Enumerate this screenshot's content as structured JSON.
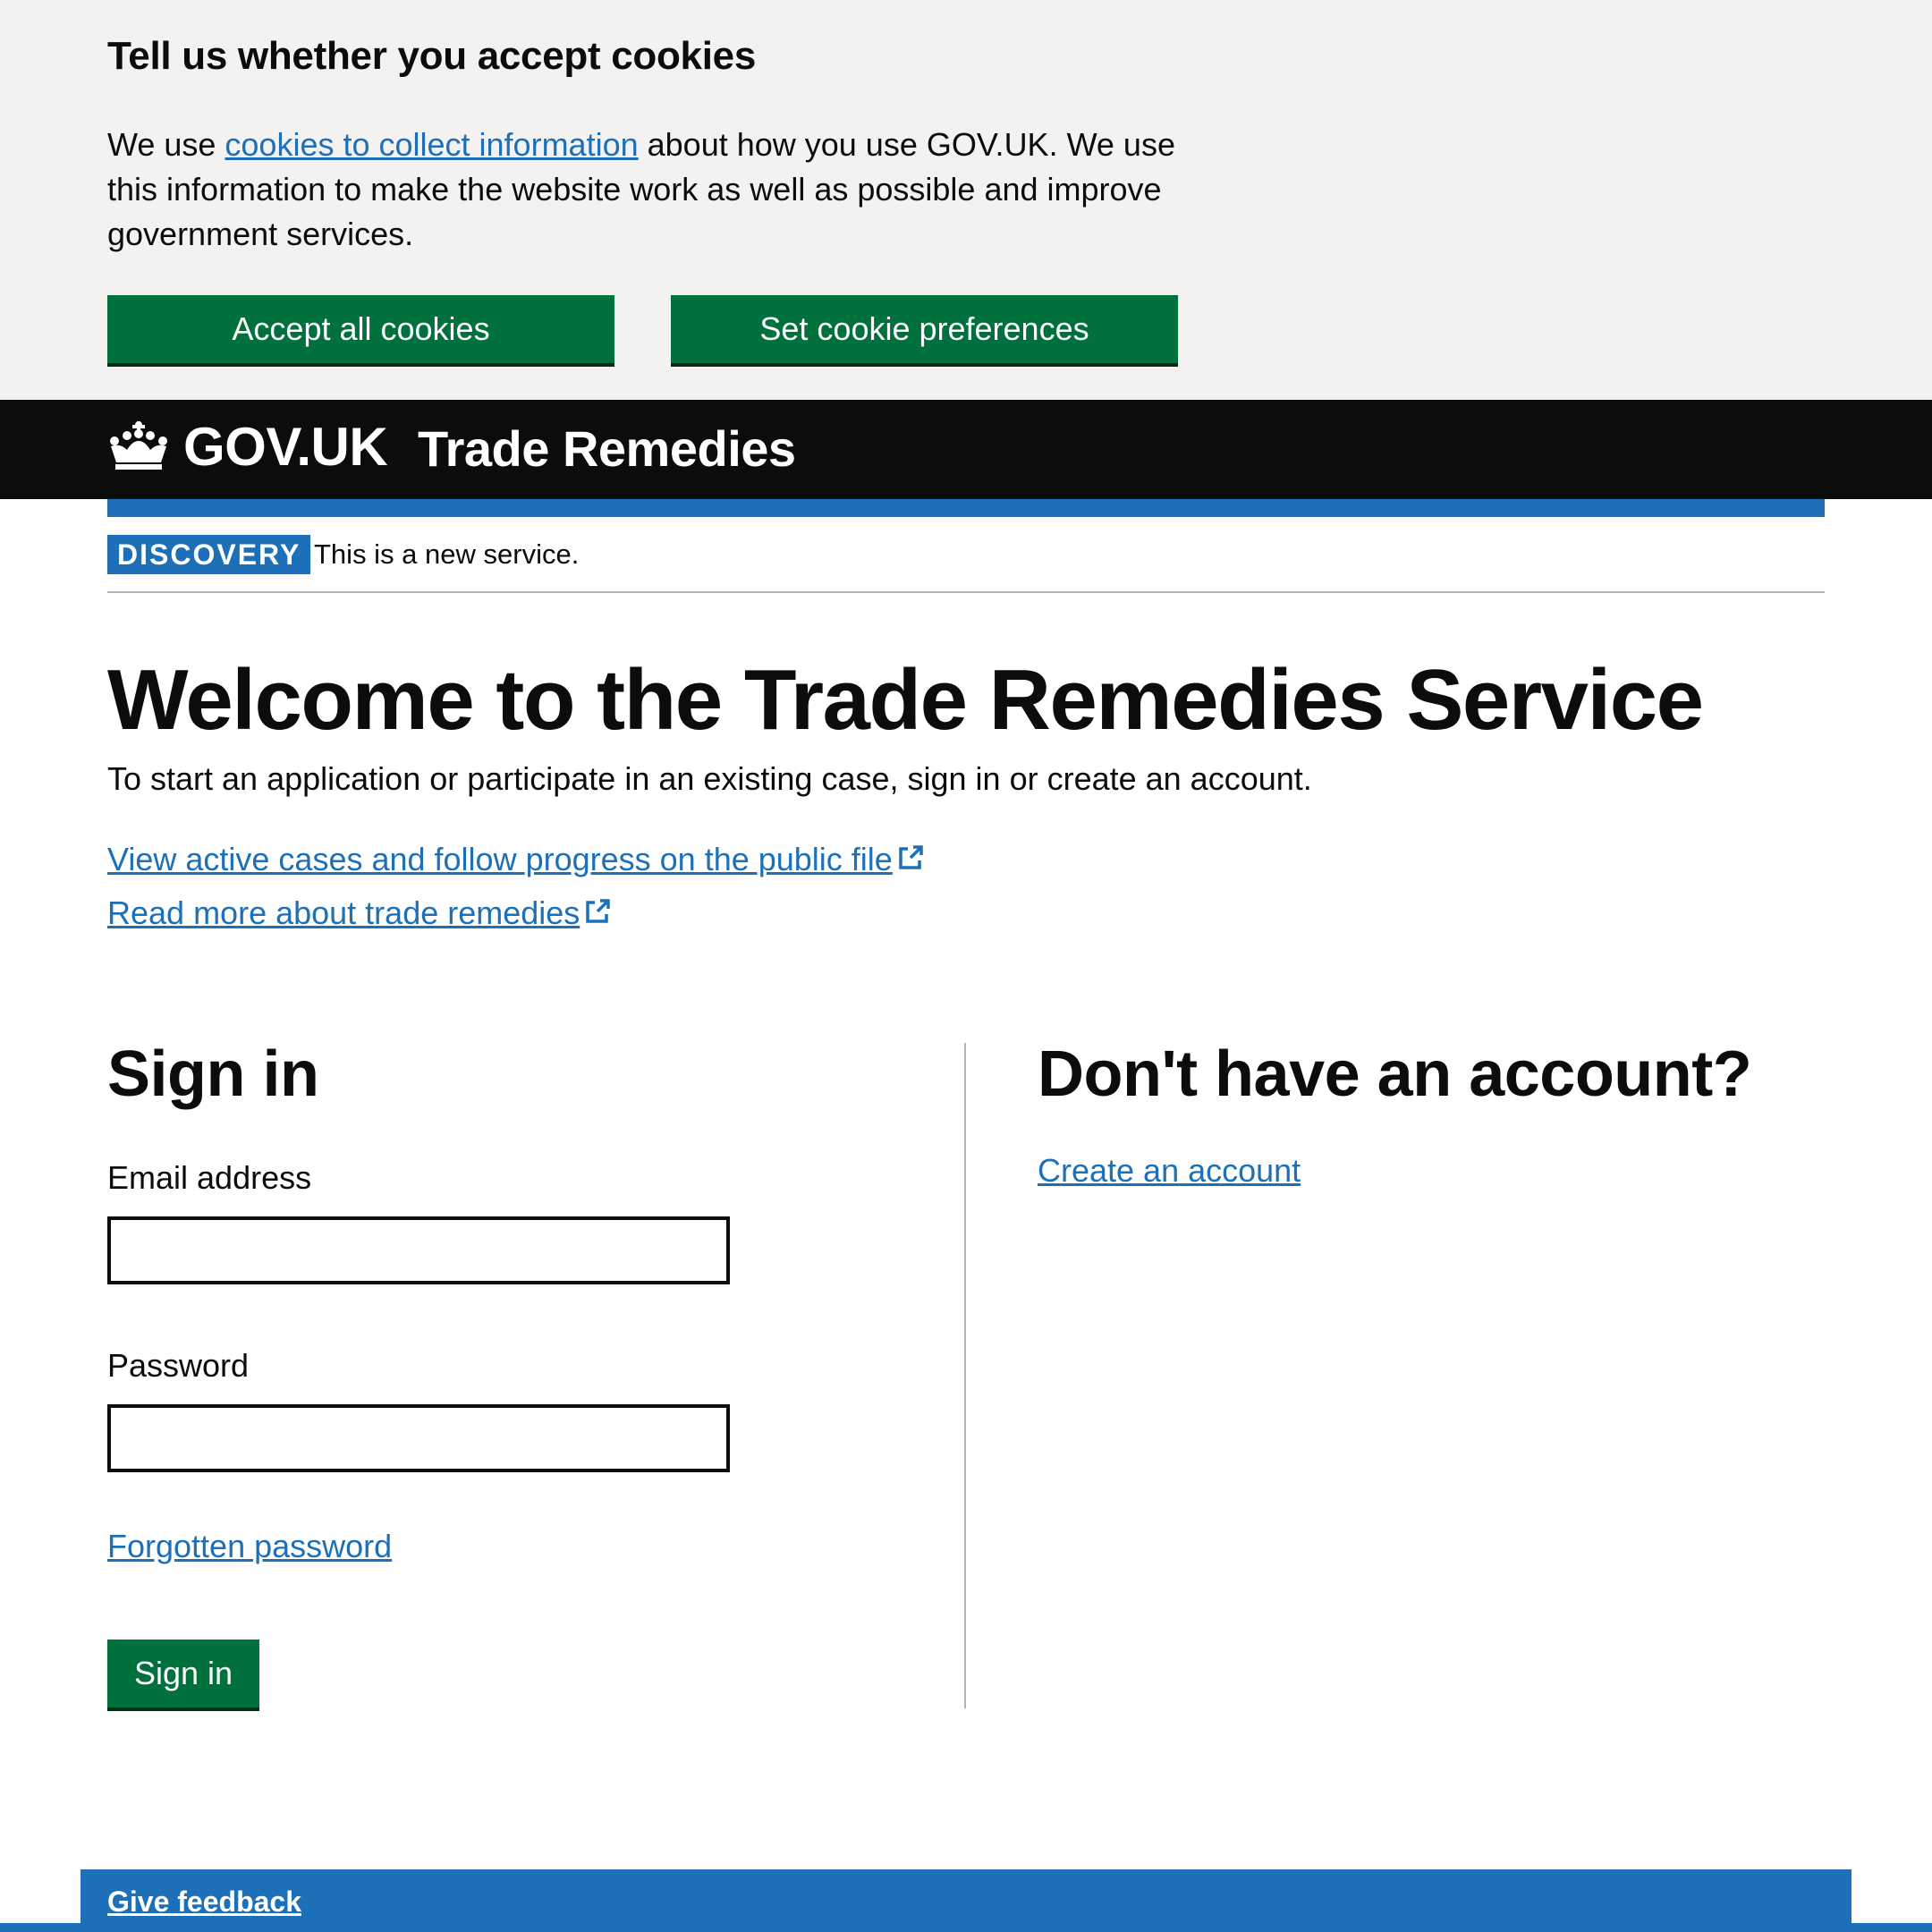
{
  "cookie_banner": {
    "title": "Tell us whether you accept cookies",
    "text_before_link": "We use ",
    "link_text": "cookies to collect information",
    "text_after_link": " about how you use GOV.UK. We use this information to make the website work as well as possible and improve government services.",
    "accept_label": "Accept all cookies",
    "prefs_label": "Set cookie preferences"
  },
  "header": {
    "logo_text": "GOV.UK",
    "service_name": "Trade Remedies",
    "logo_icon": "crown-icon"
  },
  "phase_banner": {
    "tag": "DISCOVERY",
    "text": "This is a new service."
  },
  "main": {
    "title": "Welcome to the Trade Remedies Service",
    "lead": "To start an application or participate in an existing case, sign in or create an account.",
    "links": [
      {
        "label": "View active cases and follow progress on the public file",
        "icon": "external-link-icon"
      },
      {
        "label": "Read more about trade remedies",
        "icon": "external-link-icon"
      }
    ]
  },
  "sign_in": {
    "title": "Sign in",
    "email_label": "Email address",
    "email_value": "",
    "password_label": "Password",
    "password_value": "",
    "forgot_label": "Forgotten password",
    "submit_label": "Sign in"
  },
  "no_account": {
    "title": "Don't have an account?",
    "create_label": "Create an account"
  },
  "feedback": {
    "label": "Give feedback"
  },
  "colors": {
    "brand_green": "#00703c",
    "link_blue": "#1d70b8",
    "header_black": "#0b0c0c",
    "banner_grey": "#f3f2f1"
  }
}
